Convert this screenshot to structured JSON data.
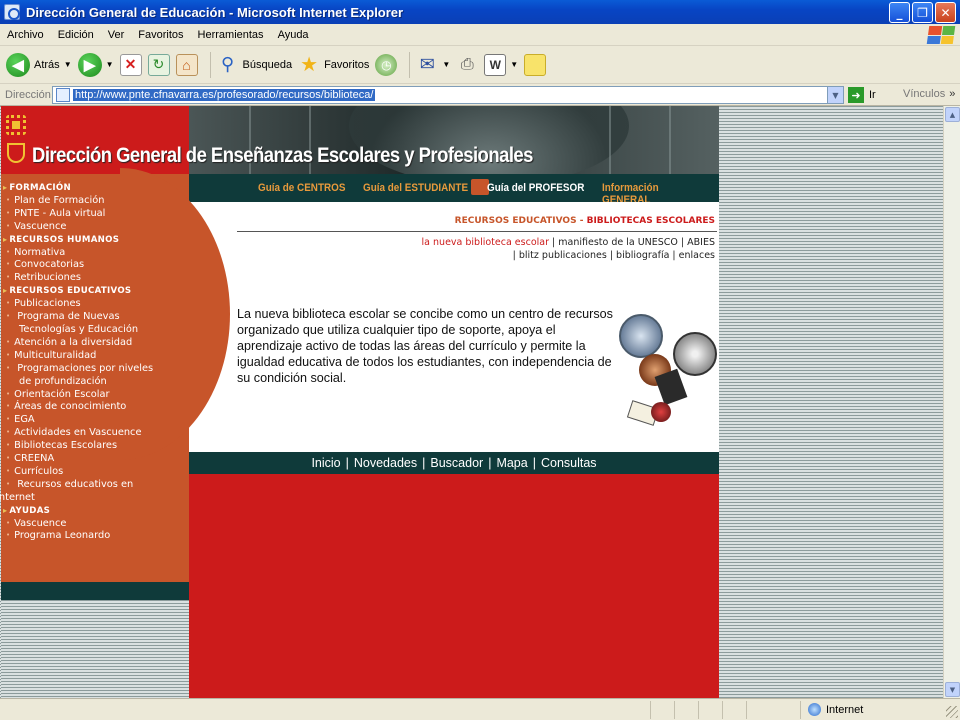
{
  "window": {
    "title": "Dirección General de Educación - Microsoft Internet Explorer",
    "buttons": {
      "minimize": "_",
      "maximize": "❐",
      "close": "✕"
    }
  },
  "menubar": [
    "Archivo",
    "Edición",
    "Ver",
    "Favoritos",
    "Herramientas",
    "Ayuda"
  ],
  "toolbar": {
    "back_label": "Atrás",
    "search_label": "Búsqueda",
    "favorites_label": "Favoritos"
  },
  "addressbar": {
    "label": "Dirección",
    "url": "http://www.pnte.cfnavarra.es/profesorado/recursos/biblioteca/",
    "go_label": "Ir",
    "links_label": "Vínculos"
  },
  "page": {
    "header_title": "Dirección General de Enseñanzas Escolares y Profesionales",
    "top_nav": [
      "Guía de CENTROS",
      "Guía del ESTUDIANTE",
      "Guía del PROFESOR",
      "Información GENERAL"
    ],
    "section_prefix": "RECURSOS EDUCATIVOS -",
    "section_title": "BIBLIOTECAS ESCOLARES",
    "sublinks_row1": {
      "current": "la nueva biblioteca escolar",
      "rest": "| manifiesto de la UNESCO | ABIES"
    },
    "sublinks_row2": "| blitz publicaciones | bibliografía | enlaces",
    "intro_text": "La nueva biblioteca escolar se concibe como un centro de recursos organizado que utiliza cualquier tipo de soporte, apoya el aprendizaje activo de todas las áreas del currículo y permite la igualdad educativa de todos los estudiantes, con independencia de su condición social.",
    "footer_nav": [
      "Inicio",
      "Novedades",
      "Buscador",
      "Mapa",
      "Consultas"
    ],
    "left_menu": {
      "formacion": {
        "title": "FORMACIÓN",
        "items": [
          "Plan de Formación",
          "PNTE - Aula virtual",
          "Vascuence"
        ]
      },
      "rrhh": {
        "title": "RECURSOS HUMANOS",
        "items": [
          "Normativa",
          "Convocatorias",
          "Retribuciones"
        ]
      },
      "recursos": {
        "title": "RECURSOS EDUCATIVOS",
        "items": [
          "Publicaciones",
          "Programa de Nuevas",
          "Tecnologías y Educación",
          "Atención a la diversidad",
          "Multiculturalidad",
          "Programaciones por niveles",
          "de profundización",
          "Orientación Escolar",
          "Áreas de conocimiento",
          "EGA",
          "Actividades en Vascuence",
          "Bibliotecas Escolares",
          "CREENA",
          "Currículos",
          "Recursos educativos en",
          "Internet"
        ]
      },
      "ayudas": {
        "title": "AYUDAS",
        "items": [
          "Vascuence",
          "Programa Leonardo"
        ]
      }
    }
  },
  "statusbar": {
    "zone": "Internet"
  }
}
